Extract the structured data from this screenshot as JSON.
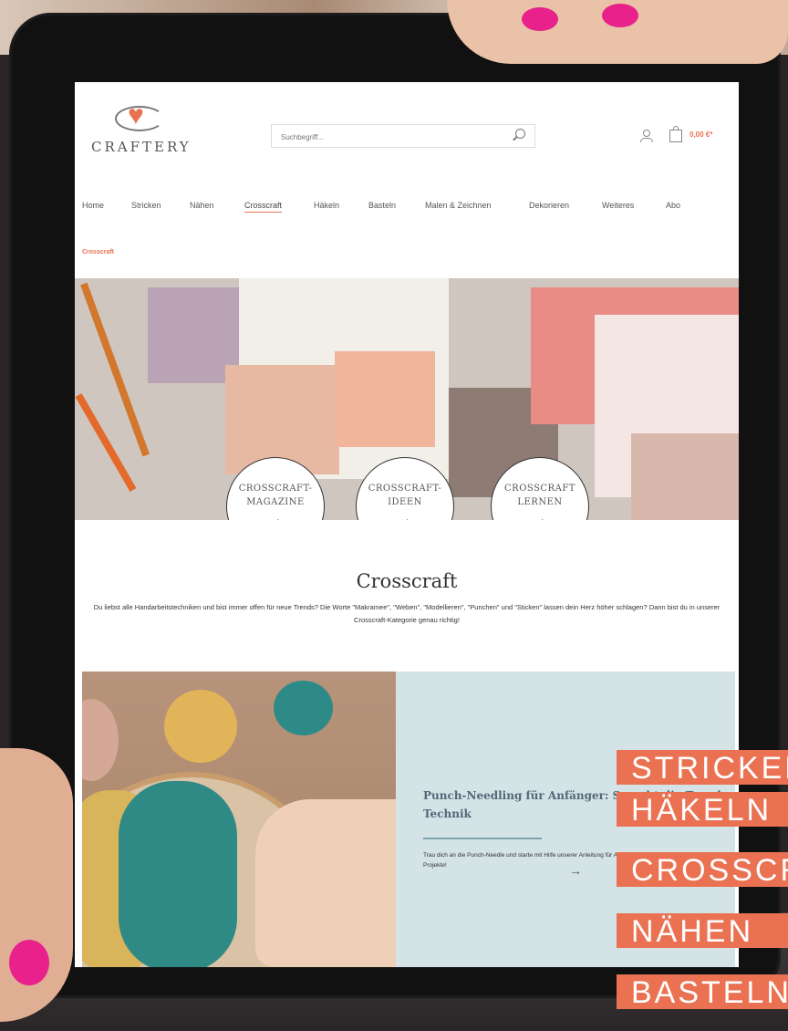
{
  "site": {
    "logo_text": "CRAFTERY",
    "search_placeholder": "Suchbegriff...",
    "cart_total": "0,00 €*"
  },
  "nav": {
    "items": [
      "Home",
      "Stricken",
      "Nähen",
      "Crosscraft",
      "Häkeln",
      "Basteln",
      "Malen & Zeichnen",
      "Dekorieren",
      "Weiteres",
      "Abo"
    ],
    "active": "Crosscraft"
  },
  "breadcrumb": "Crosscraft",
  "hero": {
    "buttons": [
      {
        "line1": "CROSSCRAFT-",
        "line2": "MAGAZINE",
        "arrow": "→"
      },
      {
        "line1": "CROSSCRAFT-",
        "line2": "IDEEN",
        "arrow": "→"
      },
      {
        "line1": "CROSSCRAFT",
        "line2": "LERNEN",
        "arrow": "→"
      }
    ]
  },
  "category": {
    "title": "Crosscraft",
    "intro": "Du liebst alle Handarbeitstechniken und bist immer offen für neue Trends? Die Worte \"Makramee\", \"Weben\", \"Modellieren\", \"Punchen\" und \"Sticken\" lassen dein Herz höher schlagen? Dann bist du in unserer Crosscraft-Kategorie genau richtig!"
  },
  "article": {
    "title": "Punch-Needling für Anfänger: So geht die Trend-Technik",
    "description": "Trau dich an die Punch-Needle und starte mit Hilfe unserer Anleitung für Anfänger sofort in deine eigenen Projekte!",
    "arrow": "→"
  },
  "overlay_tags": [
    "STRICKEN",
    "HÄKELN",
    "CROSSCRAFT",
    "NÄHEN",
    "BASTELN"
  ],
  "colors": {
    "accent": "#e8714f",
    "tag_bg": "#ea7252",
    "card_bg": "#d4e3e5",
    "card_title": "#51687a",
    "nail": "#e8218b"
  }
}
